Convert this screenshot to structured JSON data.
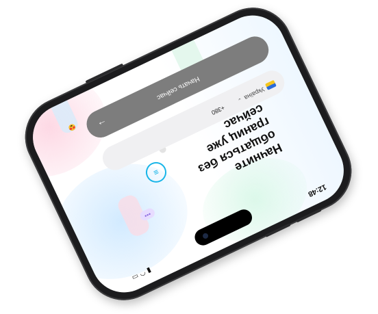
{
  "status_bar": {
    "time": "12:48",
    "icons": [
      "signal-icon",
      "wifi-icon",
      "battery-icon"
    ]
  },
  "headline": "Начните\nобщаться без\nграниц уже\nсейчас",
  "phone_input": {
    "country_name": "Україна",
    "country_flag": "ukraine-flag-icon",
    "dial_code": "+380"
  },
  "start_button": {
    "label": "Начать сейчас",
    "icon": "arrow-right-icon"
  },
  "decorations": {
    "chat_icon": "chat-bubble-icon",
    "dots": "•••",
    "emoji": "😍"
  },
  "colors": {
    "accent": "#18b5e8",
    "button": "#7d7d7d",
    "frame": "#1c1c1e"
  }
}
